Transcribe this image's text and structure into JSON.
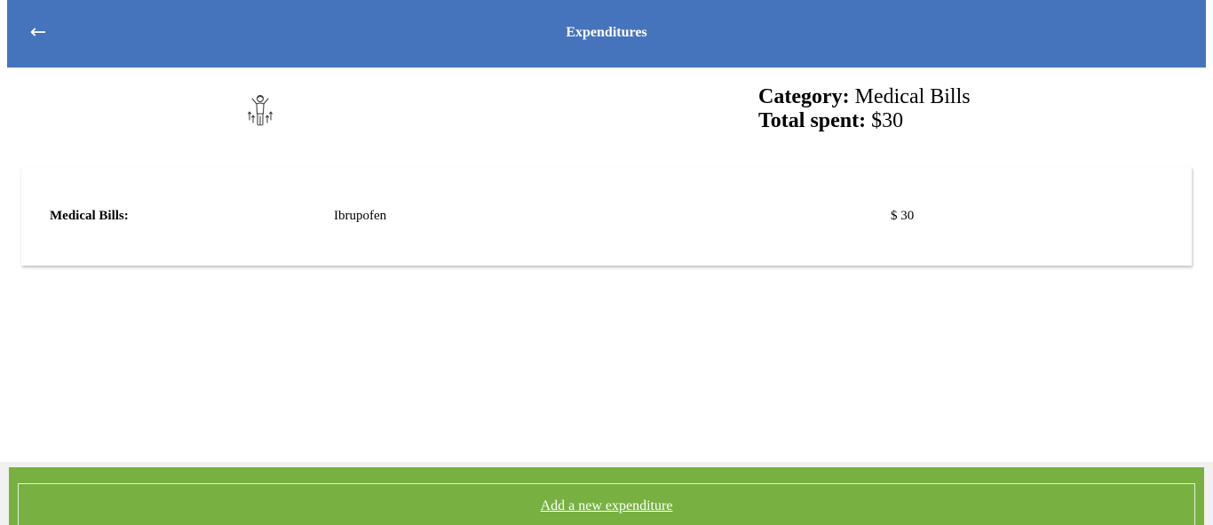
{
  "header": {
    "back_icon": "left-arrow-icon",
    "back_glyph": "←",
    "title": "Expenditures",
    "background": "#4674bc"
  },
  "summary": {
    "icon": "person-celebrating-icon",
    "category_label": "Category:",
    "category_value": "Medical Bills",
    "total_label": "Total spent:",
    "total_value": "$30"
  },
  "expenditures": [
    {
      "category": "Medical Bills:",
      "description": "Ibrupofen",
      "amount": "$ 30"
    }
  ],
  "footer": {
    "add_label": "Add a new expenditure",
    "background": "#78b141"
  }
}
